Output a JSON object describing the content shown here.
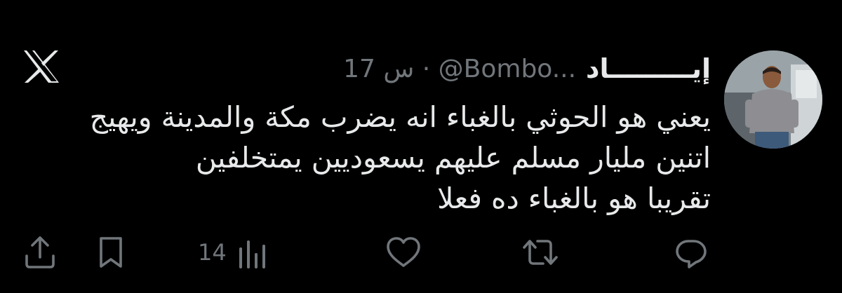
{
  "tweet": {
    "display_name": "إيـــــــــاد",
    "handle": "@Bombo...",
    "separator": "·",
    "time": "17 س",
    "text_lines": [
      "يعني هو الحوثي بالغباء انه يضرب مكة والمدينة ويهيج",
      "اتنين مليار مسلم عليهم يسعوديين يمتخلفين",
      "تقريبا هو بالغباء ده فعلا"
    ]
  },
  "actions": {
    "views_count": "14"
  },
  "icons": {
    "logo": "x-logo-icon",
    "reply": "reply-icon",
    "repost": "repost-icon",
    "like": "heart-icon",
    "views": "views-icon",
    "bookmark": "bookmark-icon",
    "share": "share-icon"
  },
  "colors": {
    "background": "#000000",
    "primary_text": "#e7e9ea",
    "secondary_text": "#71767b"
  }
}
